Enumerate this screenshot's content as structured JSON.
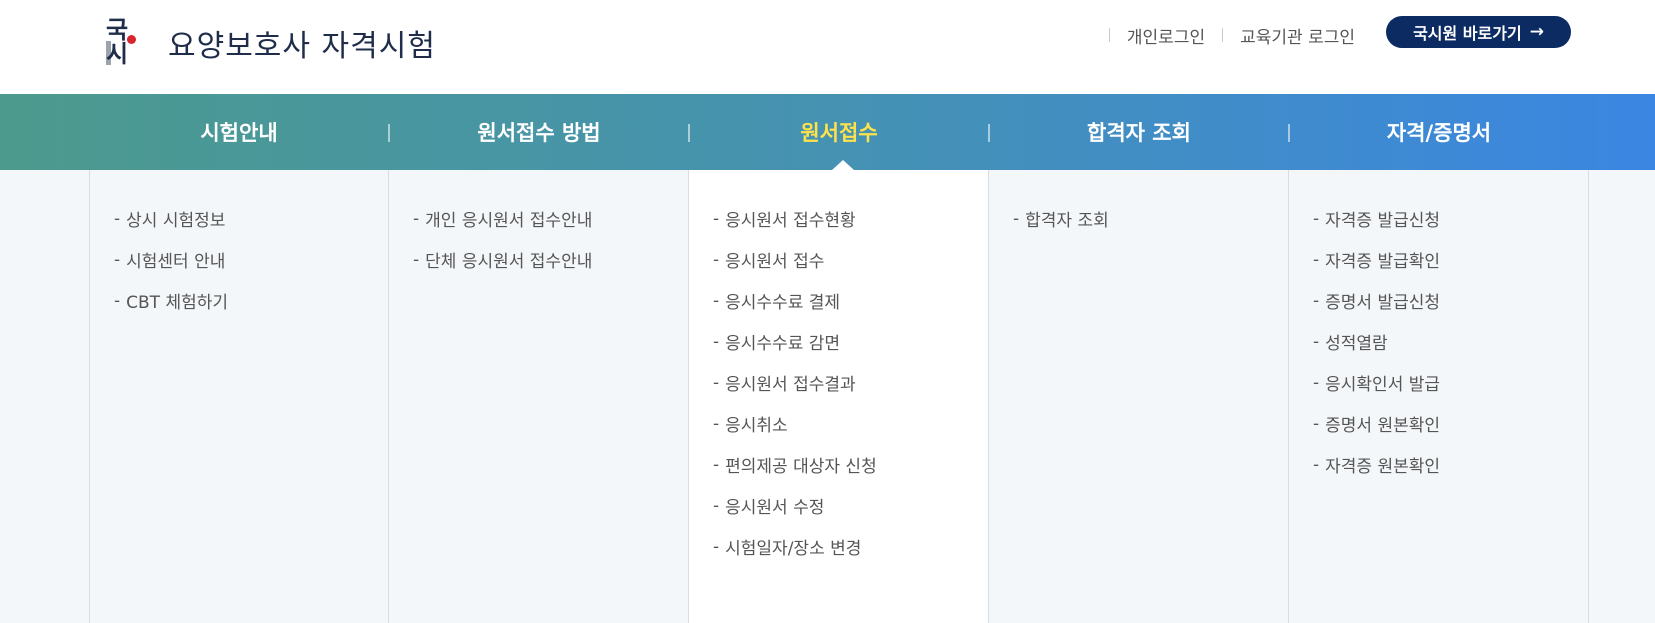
{
  "logo": {
    "line1": "국",
    "line2": "시",
    "title": "요양보호사 자격시험"
  },
  "util": {
    "personal_login": "개인로그인",
    "institution_login": "교육기관 로그인"
  },
  "shortcut": {
    "label": "국시원 바로가기",
    "arrow": "→"
  },
  "gnb": [
    {
      "label": "시험안내"
    },
    {
      "label": "원서접수 방법"
    },
    {
      "label": "원서접수",
      "active": true
    },
    {
      "label": "합격자 조회"
    },
    {
      "label": "자격/증명서"
    }
  ],
  "submenus": [
    {
      "items": [
        "상시 시험정보",
        "시험센터 안내",
        "CBT 체험하기"
      ]
    },
    {
      "items": [
        "개인 응시원서 접수안내",
        "단체 응시원서 접수안내"
      ]
    },
    {
      "items": [
        "응시원서 접수현황",
        "응시원서 접수",
        "응시수수료 결제",
        "응시수수료 감면",
        "응시원서 접수결과",
        "응시취소",
        "편의제공 대상자 신청",
        "응시원서 수정",
        "시험일자/장소 변경"
      ]
    },
    {
      "items": [
        "합격자 조회"
      ]
    },
    {
      "items": [
        "자격증 발급신청",
        "자격증 발급확인",
        "증명서 발급신청",
        "성적열람",
        "응시확인서 발급",
        "증명서 원본확인",
        "자격증 원본확인"
      ]
    }
  ],
  "colors": {
    "brand_navy": "#0c2b63",
    "active_menu": "#ffe24a",
    "gradient_start": "#4c9a8d",
    "gradient_end": "#3b86e2"
  }
}
